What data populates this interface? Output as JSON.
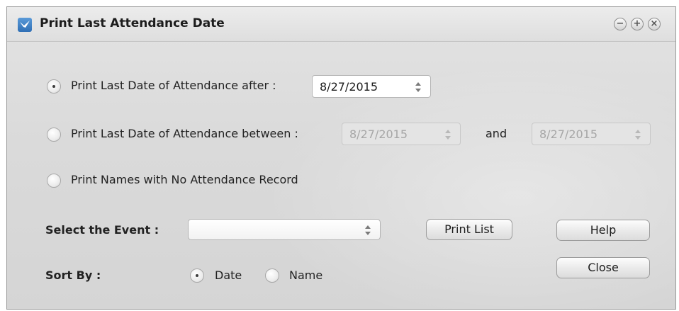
{
  "window": {
    "title": "Print Last Attendance Date",
    "controls": [
      "minimize-icon",
      "maximize-icon",
      "close-icon"
    ]
  },
  "options": {
    "after": {
      "label": "Print Last Date of Attendance after :",
      "selected": true,
      "date": "8/27/2015"
    },
    "between": {
      "label": "Print Last Date of Attendance between :",
      "selected": false,
      "from_date": "8/27/2015",
      "and_label": "and",
      "to_date": "8/27/2015"
    },
    "no_record": {
      "label": "Print Names with No Attendance Record",
      "selected": false
    }
  },
  "event": {
    "label": "Select the Event :",
    "value": ""
  },
  "sort": {
    "label": "Sort By :",
    "date_label": "Date",
    "name_label": "Name",
    "selected": "Date"
  },
  "buttons": {
    "print_list": "Print List",
    "help": "Help",
    "close": "Close"
  },
  "colors": {
    "title_icon": "#2f6fb5",
    "window_bg": "#dadada",
    "disabled_text": "#a6a6a6"
  }
}
